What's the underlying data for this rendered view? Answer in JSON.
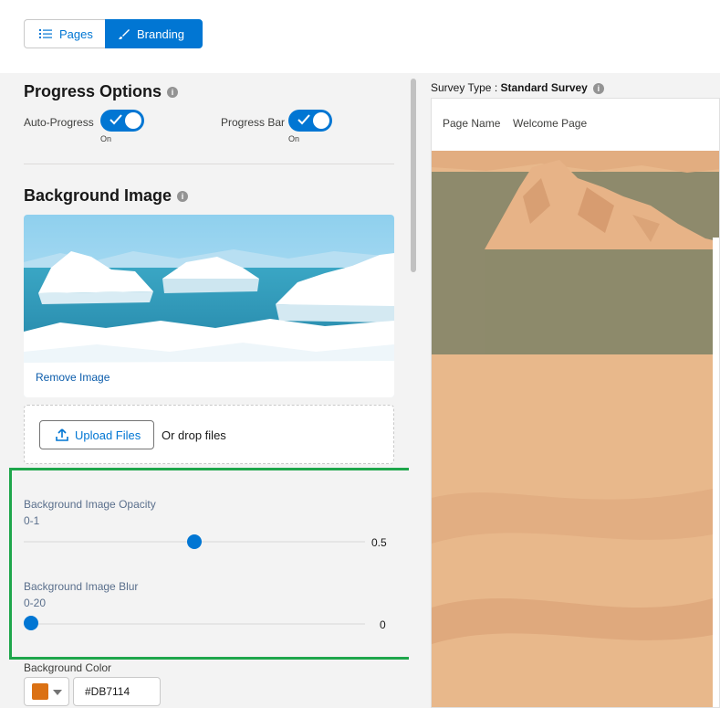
{
  "tabs": {
    "pages": "Pages",
    "branding": "Branding"
  },
  "progress": {
    "title": "Progress Options",
    "auto_progress": {
      "label": "Auto-Progress",
      "state": "On"
    },
    "progress_bar": {
      "label": "Progress Bar",
      "state": "On"
    }
  },
  "background_image": {
    "title": "Background Image",
    "remove_link": "Remove Image",
    "upload_button": "Upload Files",
    "drop_text": "Or drop files"
  },
  "sliders": {
    "opacity": {
      "label": "Background Image Opacity",
      "range": "0-1",
      "value": "0.5",
      "min": 0,
      "max": 1,
      "current": 0.5
    },
    "blur": {
      "label": "Background Image Blur",
      "range": "0-20",
      "value": "0",
      "min": 0,
      "max": 20,
      "current": 0
    }
  },
  "background_color": {
    "label": "Background Color",
    "value": "#DB7114",
    "swatch": "#db7114"
  },
  "preview": {
    "survey_type_label": "Survey Type : ",
    "survey_type_value": "Standard Survey",
    "page_name_label": "Page Name",
    "page_name_value": "Welcome Page"
  },
  "colors": {
    "accent": "#0176d3",
    "highlight": "#1ea64b"
  }
}
